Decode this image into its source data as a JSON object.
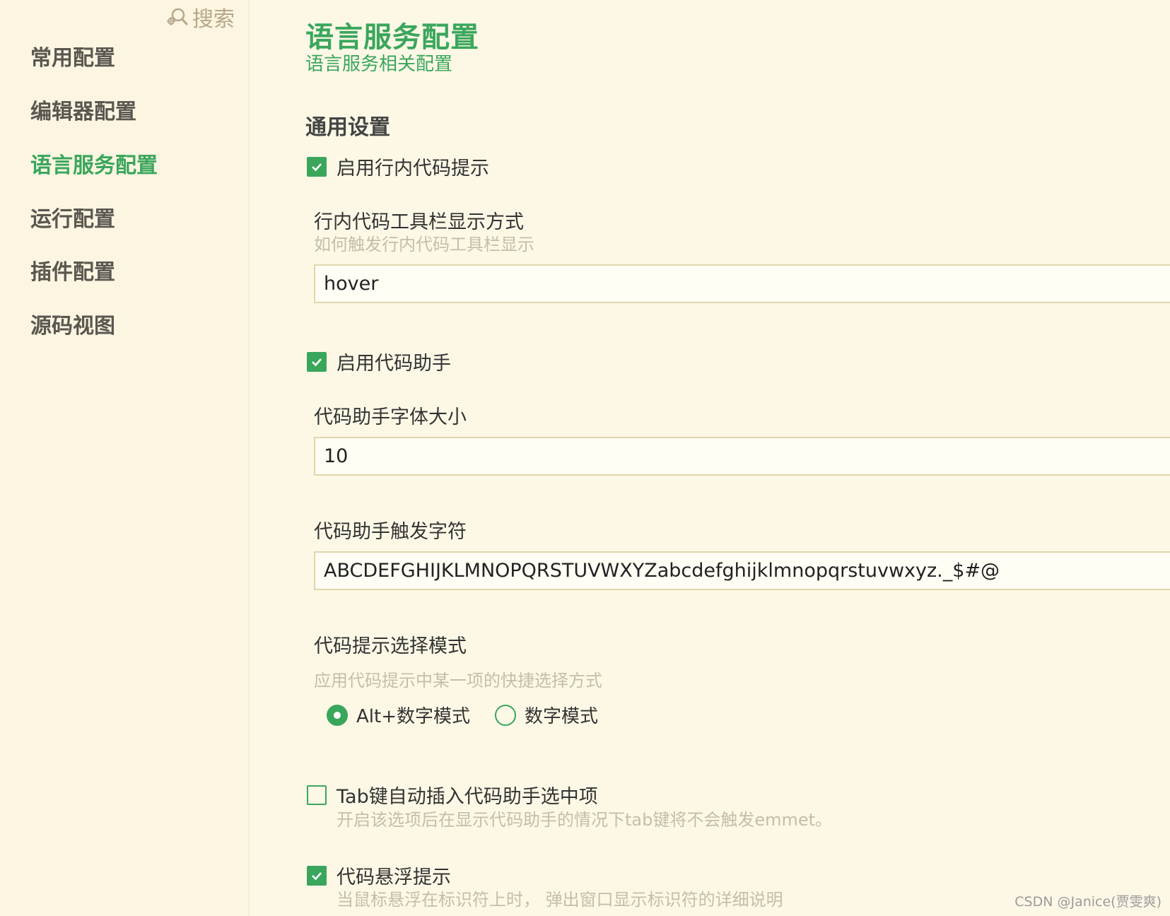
{
  "sidebar": {
    "search_label": "搜索",
    "search_icon": "search-icon",
    "items": [
      {
        "label": "常用配置",
        "active": false
      },
      {
        "label": "编辑器配置",
        "active": false
      },
      {
        "label": "语言服务配置",
        "active": true
      },
      {
        "label": "运行配置",
        "active": false
      },
      {
        "label": "插件配置",
        "active": false
      },
      {
        "label": "源码视图",
        "active": false
      }
    ]
  },
  "main": {
    "title": "语言服务配置",
    "subtitle": "语言服务相关配置",
    "section_title": "通用设置",
    "inline_hint": {
      "label": "启用行内代码提示",
      "checked": true
    },
    "inline_toolbar": {
      "label": "行内代码工具栏显示方式",
      "description": "如何触发行内代码工具栏显示",
      "value": "hover"
    },
    "code_assist": {
      "label": "启用代码助手",
      "checked": true
    },
    "assist_font_size": {
      "label": "代码助手字体大小",
      "value": "10"
    },
    "assist_trigger_chars": {
      "label": "代码助手触发字符",
      "value": "ABCDEFGHIJKLMNOPQRSTUVWXYZabcdefghijklmnopqrstuvwxyz._$#@"
    },
    "hint_select_mode": {
      "label": "代码提示选择模式",
      "description": "应用代码提示中某一项的快捷选择方式",
      "options": [
        {
          "label": "Alt+数字模式",
          "selected": true
        },
        {
          "label": "数字模式",
          "selected": false
        }
      ]
    },
    "tab_insert": {
      "label": "Tab键自动插入代码助手选中项",
      "description": "开启该选项后在显示代码助手的情况下tab键将不会触发emmet。",
      "checked": false
    },
    "hover_hint": {
      "label": "代码悬浮提示",
      "description": "当鼠标悬浮在标识符上时， 弹出窗口显示标识符的详细说明",
      "checked": true
    }
  },
  "watermark": "CSDN @Janice(贾雯爽)",
  "colors": {
    "accent": "#3aa65c",
    "background": "#fdf8e6",
    "input_border": "#e1d6ac",
    "muted_text": "#c4bea8"
  }
}
